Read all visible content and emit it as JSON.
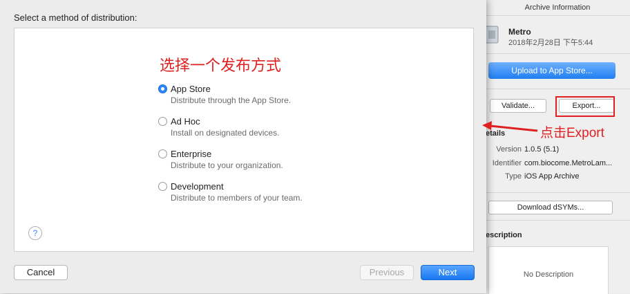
{
  "sheet": {
    "title": "Select a method of distribution:",
    "annotation_cn": "选择一个发布方式",
    "options": [
      {
        "label": "App Store",
        "description": "Distribute through the App Store.",
        "selected": true
      },
      {
        "label": "Ad Hoc",
        "description": "Install on designated devices.",
        "selected": false
      },
      {
        "label": "Enterprise",
        "description": "Distribute to your organization.",
        "selected": false
      },
      {
        "label": "Development",
        "description": "Distribute to members of your team.",
        "selected": false
      }
    ],
    "help_label": "?",
    "buttons": {
      "cancel": "Cancel",
      "previous": "Previous",
      "next": "Next"
    }
  },
  "inspector": {
    "header": "Archive Information",
    "archive_name": "Metro",
    "archive_date": "2018年2月28日 下午5:44",
    "upload_button": "Upload to App Store...",
    "validate_button": "Validate...",
    "export_button": "Export...",
    "details_title": "etails",
    "details": [
      {
        "key": "Version",
        "value": "1.0.5 (5.1)"
      },
      {
        "key": "Identifier",
        "value": "com.biocome.MetroLam..."
      },
      {
        "key": "Type",
        "value": "iOS App Archive"
      }
    ],
    "download_dsyms_button": "Download dSYMs...",
    "description_title": "escription",
    "no_description": "No Description"
  },
  "annotation": {
    "export_hint": "点击Export",
    "accent_color": "#e02020"
  },
  "colors": {
    "primary_blue": "#1f7ff2",
    "radio_selected": "#2c86f5"
  }
}
